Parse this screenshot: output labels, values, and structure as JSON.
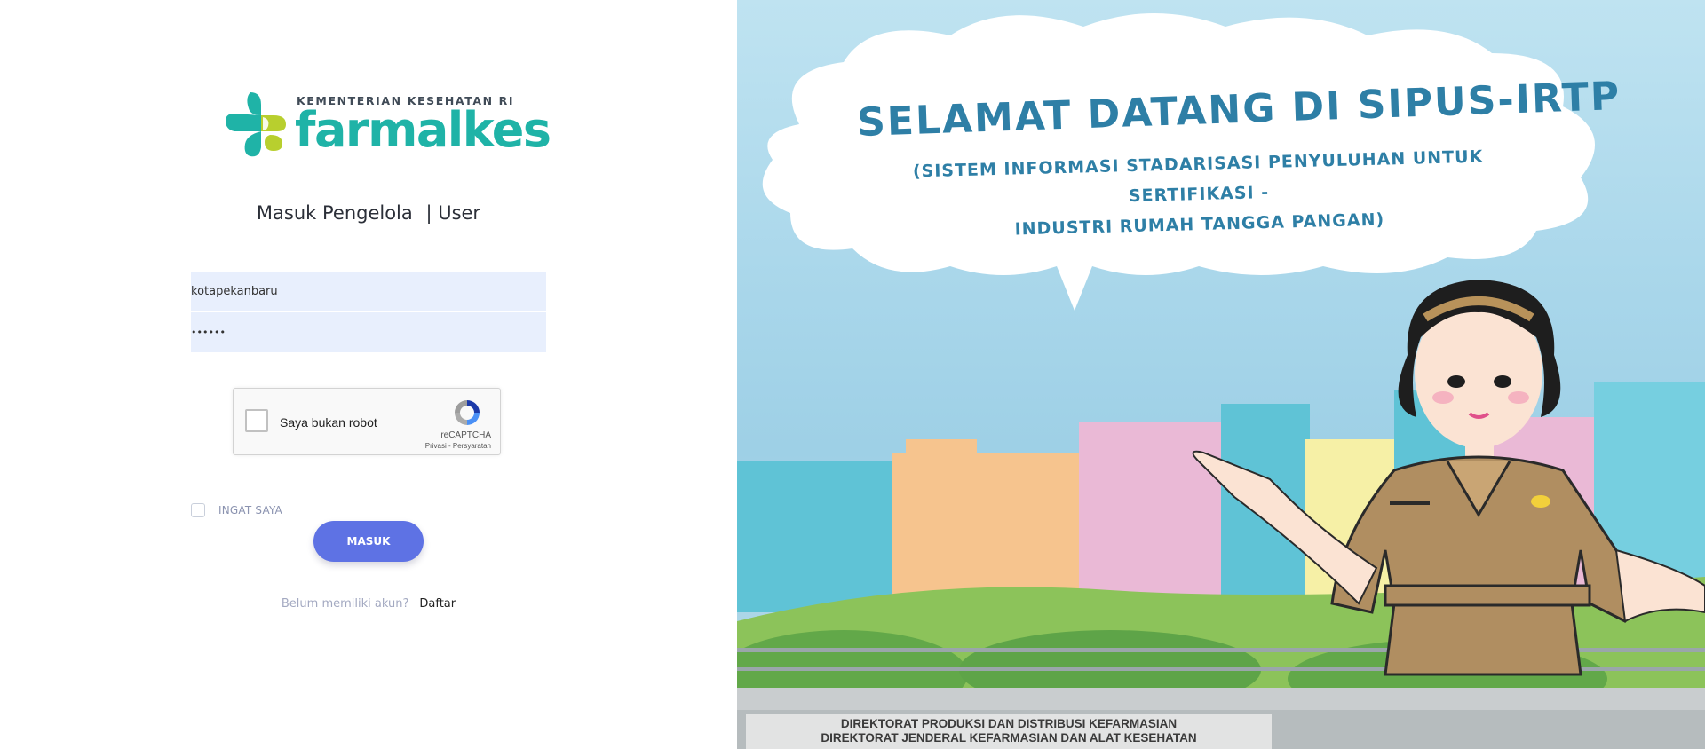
{
  "logo": {
    "subtitle": "KEMENTERIAN KESEHATAN RI",
    "name": "farmalkes",
    "colors": {
      "teal": "#1fb3a7",
      "lime": "#b8cf2e"
    }
  },
  "tabs": {
    "pengelola": "Masuk Pengelola",
    "user": "| User"
  },
  "form": {
    "username": {
      "value": "kotapekanbaru"
    },
    "password": {
      "value": "••••••"
    },
    "recaptcha": {
      "label": "Saya bukan robot",
      "brand": "reCAPTCHA",
      "links": "Privasi - Persyaratan"
    },
    "remember_label": "INGAT SAYA",
    "submit_label": "MASUK"
  },
  "signup": {
    "question": "Belum memiliki akun?",
    "link": "Daftar"
  },
  "banner": {
    "heading": "SELAMAT DATANG DI SIPUS-IRTP",
    "subheading_line1": "(SISTEM INFORMASI STADARISASI PENYULUHAN UNTUK SERTIFIKASI -",
    "subheading_line2": "INDUSTRI RUMAH TANGGA PANGAN)",
    "footer_line1": "DIREKTORAT PRODUKSI DAN DISTRIBUSI KEFARMASIAN",
    "footer_line2": "DIREKTORAT JENDERAL KEFARMASIAN DAN ALAT KESEHATAN"
  },
  "colors": {
    "primary_button": "#5e72e4",
    "input_bg": "#e8effd",
    "heading_text": "#2e7fa6"
  }
}
